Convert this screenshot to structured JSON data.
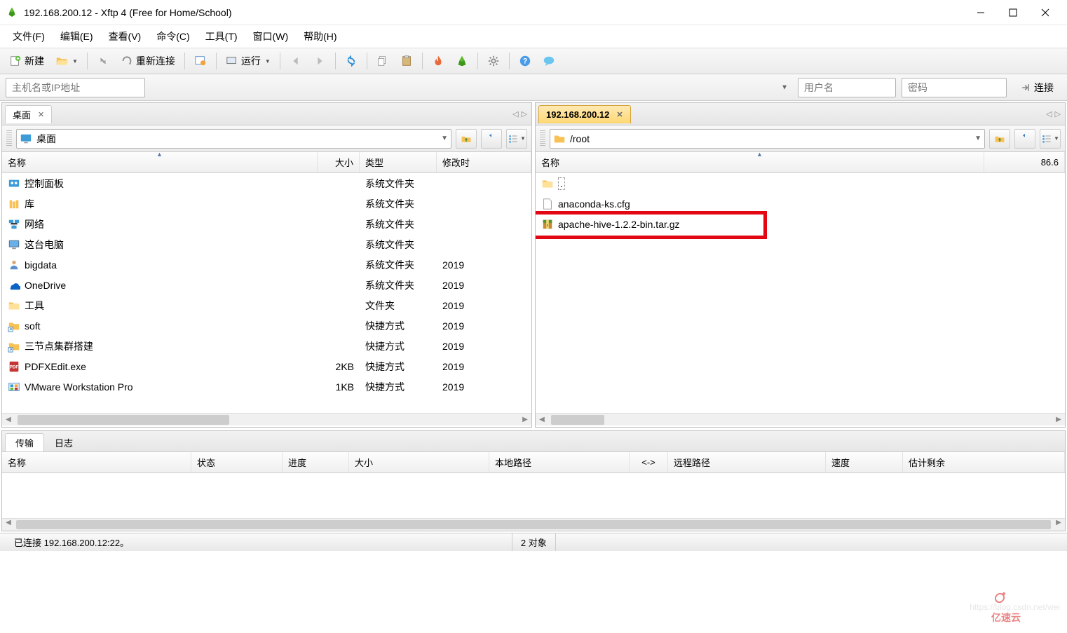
{
  "window": {
    "title": "192.168.200.12 - Xftp 4 (Free for Home/School)"
  },
  "menu": {
    "file": "文件(F)",
    "edit": "编辑(E)",
    "view": "查看(V)",
    "cmd": "命令(C)",
    "tools": "工具(T)",
    "window": "窗口(W)",
    "help": "帮助(H)"
  },
  "toolbar": {
    "new": "新建",
    "reconnect": "重新连接",
    "run": "运行"
  },
  "addr": {
    "host_ph": "主机名或IP地址",
    "user_ph": "用户名",
    "pass_ph": "密码",
    "connect": "连接"
  },
  "localPane": {
    "tab": "桌面",
    "path": "桌面",
    "cols": {
      "name": "名称",
      "size": "大小",
      "type": "类型",
      "mtime": "修改时"
    },
    "colWidths": {
      "name": 450,
      "size": 60,
      "type": 110,
      "mtime": 56
    },
    "rows": [
      {
        "icon": "ctrl",
        "name": "控制面板",
        "size": "",
        "type": "系统文件夹",
        "mtime": ""
      },
      {
        "icon": "lib",
        "name": "库",
        "size": "",
        "type": "系统文件夹",
        "mtime": ""
      },
      {
        "icon": "net",
        "name": "网络",
        "size": "",
        "type": "系统文件夹",
        "mtime": ""
      },
      {
        "icon": "pc",
        "name": "这台电脑",
        "size": "",
        "type": "系统文件夹",
        "mtime": ""
      },
      {
        "icon": "user",
        "name": "bigdata",
        "size": "",
        "type": "系统文件夹",
        "mtime": "2019"
      },
      {
        "icon": "onedrive",
        "name": "OneDrive",
        "size": "",
        "type": "系统文件夹",
        "mtime": "2019"
      },
      {
        "icon": "folder",
        "name": "工具",
        "size": "",
        "type": "文件夹",
        "mtime": "2019"
      },
      {
        "icon": "shortcut",
        "name": "soft",
        "size": "",
        "type": "快捷方式",
        "mtime": "2019"
      },
      {
        "icon": "shortcut",
        "name": "三节点集群搭建",
        "size": "",
        "type": "快捷方式",
        "mtime": "2019"
      },
      {
        "icon": "pdf",
        "name": "PDFXEdit.exe",
        "size": "2KB",
        "type": "快捷方式",
        "mtime": "2019"
      },
      {
        "icon": "vmware",
        "name": "VMware Workstation Pro",
        "size": "1KB",
        "type": "快捷方式",
        "mtime": "2019"
      }
    ]
  },
  "remotePane": {
    "tab": "192.168.200.12",
    "path": "/root",
    "cols": {
      "name": "名称",
      "size_trunc": "86.6"
    },
    "colWidths": {
      "name": 640
    },
    "rows": [
      {
        "icon": "folder",
        "name": "."
      },
      {
        "icon": "file",
        "name": "anaconda-ks.cfg"
      },
      {
        "icon": "archive",
        "name": "apache-hive-1.2.2-bin.tar.gz",
        "highlighted": true
      }
    ]
  },
  "transfer": {
    "tab1": "传输",
    "tab2": "日志",
    "cols": {
      "name": "名称",
      "status": "状态",
      "progress": "进度",
      "size": "大小",
      "local": "本地路径",
      "arrow": "<->",
      "remote": "远程路径",
      "speed": "速度",
      "eta": "估计剩余"
    }
  },
  "status": {
    "conn": "已连接 192.168.200.12:22。",
    "objects": "2 对象"
  },
  "watermark": "https://blog.csdn.net/wei",
  "brand": "亿速云"
}
